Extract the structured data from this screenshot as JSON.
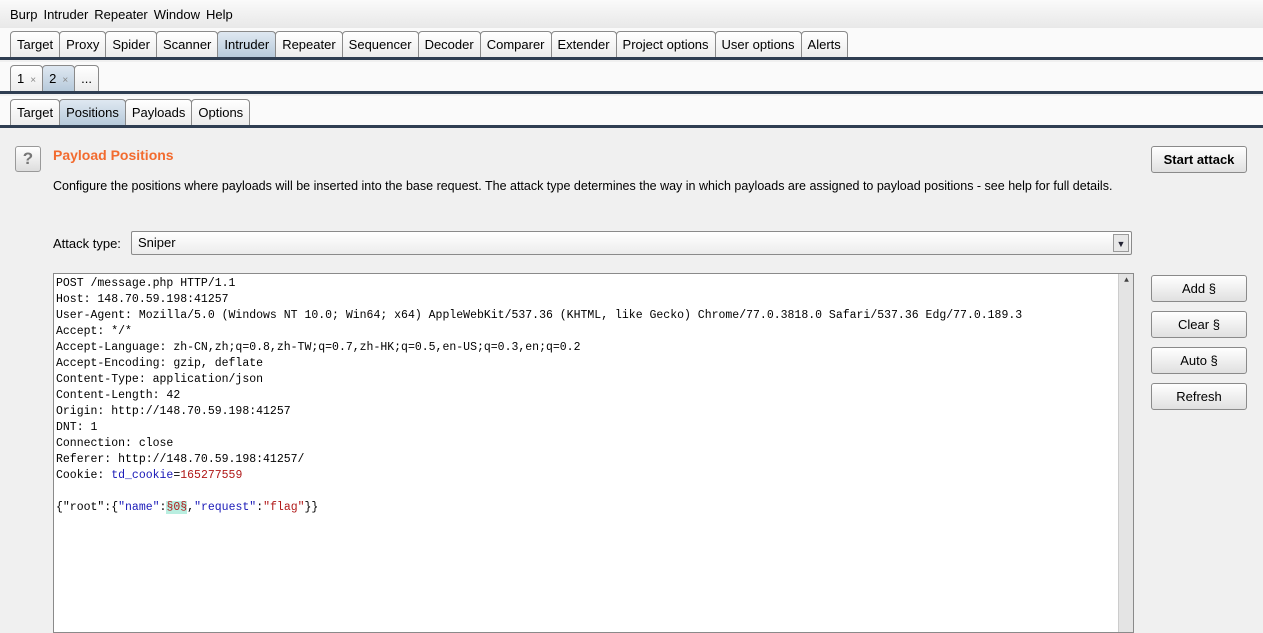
{
  "menu": [
    "Burp",
    "Intruder",
    "Repeater",
    "Window",
    "Help"
  ],
  "main_tabs": [
    {
      "label": "Target"
    },
    {
      "label": "Proxy"
    },
    {
      "label": "Spider"
    },
    {
      "label": "Scanner"
    },
    {
      "label": "Intruder",
      "active": true
    },
    {
      "label": "Repeater"
    },
    {
      "label": "Sequencer"
    },
    {
      "label": "Decoder"
    },
    {
      "label": "Comparer"
    },
    {
      "label": "Extender"
    },
    {
      "label": "Project options"
    },
    {
      "label": "User options"
    },
    {
      "label": "Alerts"
    }
  ],
  "attack_tabs": [
    {
      "label": "1",
      "close": "×"
    },
    {
      "label": "2",
      "close": "×",
      "active": true
    },
    {
      "label": "..."
    }
  ],
  "sub_tabs": [
    {
      "label": "Target"
    },
    {
      "label": "Positions",
      "active": true
    },
    {
      "label": "Payloads"
    },
    {
      "label": "Options"
    }
  ],
  "panel": {
    "help": "?",
    "title": "Payload Positions",
    "description": "Configure the positions where payloads will be inserted into the base request. The attack type determines the way in which payloads are assigned to payload positions - see help for full details.",
    "start_attack": "Start attack",
    "attack_type_label": "Attack type:",
    "attack_type_value": "Sniper"
  },
  "side_buttons": {
    "add": "Add §",
    "clear": "Clear §",
    "auto": "Auto §",
    "refresh": "Refresh"
  },
  "request": {
    "lines": [
      "POST /message.php HTTP/1.1",
      "Host: 148.70.59.198:41257",
      "User-Agent: Mozilla/5.0 (Windows NT 10.0; Win64; x64) AppleWebKit/537.36 (KHTML, like Gecko) Chrome/77.0.3818.0 Safari/537.36 Edg/77.0.189.3",
      "Accept: */*",
      "Accept-Language: zh-CN,zh;q=0.8,zh-TW;q=0.7,zh-HK;q=0.5,en-US;q=0.3,en;q=0.2",
      "Accept-Encoding: gzip, deflate",
      "Content-Type: application/json",
      "Content-Length: 42",
      "Origin: http://148.70.59.198:41257",
      "DNT: 1",
      "Connection: close",
      "Referer: http://148.70.59.198:41257/"
    ],
    "cookie_prefix": "Cookie: ",
    "cookie_name": "td_cookie",
    "cookie_eq": "=",
    "cookie_value": "165277559",
    "body": {
      "p1": "{\"root\":{",
      "k1": "\"name\"",
      "c1": ":",
      "marker": "§0§",
      "c2": ",",
      "k2": "\"request\"",
      "c3": ":",
      "v2": "\"flag\"",
      "end": "}}"
    }
  },
  "colors": {
    "title": "#f26b2f",
    "tab_border": "#2f3e52",
    "marker_bg": "#b9eee0"
  }
}
